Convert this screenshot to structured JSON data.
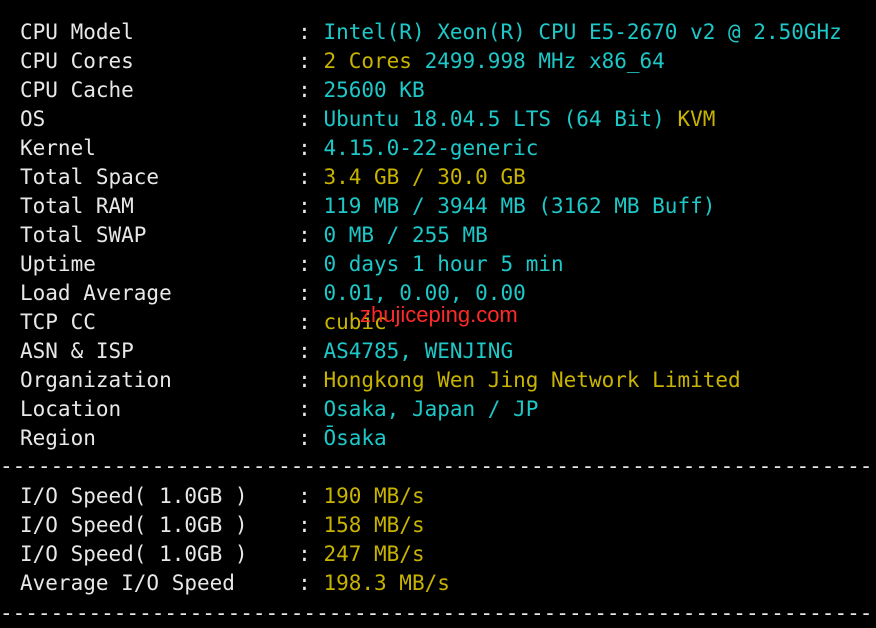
{
  "colors": {
    "cyan": "#1ec8c8",
    "yellow": "#c8b400",
    "text": "#e8e8e8",
    "background": "#000000",
    "watermark": "#ff2a2a"
  },
  "separator": ": ",
  "divider": "------------------------------------------------------------------------",
  "system": [
    {
      "label": "CPU Model",
      "parts": [
        {
          "t": "Intel(R) Xeon(R) CPU E5-2670 v2 @ 2.50GHz",
          "c": "c"
        }
      ]
    },
    {
      "label": "CPU Cores",
      "parts": [
        {
          "t": "2 Cores ",
          "c": "y"
        },
        {
          "t": "2499.998 MHz x86_64",
          "c": "c"
        }
      ]
    },
    {
      "label": "CPU Cache",
      "parts": [
        {
          "t": "25600 KB",
          "c": "c"
        }
      ]
    },
    {
      "label": "OS",
      "parts": [
        {
          "t": "Ubuntu 18.04.5 LTS (64 Bit) ",
          "c": "c"
        },
        {
          "t": "KVM",
          "c": "y"
        }
      ]
    },
    {
      "label": "Kernel",
      "parts": [
        {
          "t": "4.15.0-22-generic",
          "c": "c"
        }
      ]
    },
    {
      "label": "Total Space",
      "parts": [
        {
          "t": "3.4 GB / 30.0 GB",
          "c": "y"
        }
      ]
    },
    {
      "label": "Total RAM",
      "parts": [
        {
          "t": "119 MB / 3944 MB (3162 MB Buff)",
          "c": "c"
        }
      ]
    },
    {
      "label": "Total SWAP",
      "parts": [
        {
          "t": "0 MB / 255 MB",
          "c": "c"
        }
      ]
    },
    {
      "label": "Uptime",
      "parts": [
        {
          "t": "0 days 1 hour 5 min",
          "c": "c"
        }
      ]
    },
    {
      "label": "Load Average",
      "parts": [
        {
          "t": "0.01, 0.00, 0.00",
          "c": "c"
        }
      ]
    },
    {
      "label": "TCP CC",
      "parts": [
        {
          "t": "cubic",
          "c": "y"
        }
      ]
    },
    {
      "label": "ASN & ISP",
      "parts": [
        {
          "t": "AS4785, WENJING",
          "c": "c"
        }
      ]
    },
    {
      "label": "Organization",
      "parts": [
        {
          "t": "Hongkong Wen Jing Network Limited",
          "c": "y"
        }
      ]
    },
    {
      "label": "Location",
      "parts": [
        {
          "t": "Osaka, Japan / JP",
          "c": "c"
        }
      ]
    },
    {
      "label": "Region",
      "parts": [
        {
          "t": "Ōsaka",
          "c": "c"
        }
      ]
    }
  ],
  "io": [
    {
      "label": "I/O Speed( 1.0GB )",
      "parts": [
        {
          "t": "190 MB/s",
          "c": "y"
        }
      ]
    },
    {
      "label": "I/O Speed( 1.0GB )",
      "parts": [
        {
          "t": "158 MB/s",
          "c": "y"
        }
      ]
    },
    {
      "label": "I/O Speed( 1.0GB )",
      "parts": [
        {
          "t": "247 MB/s",
          "c": "y"
        }
      ]
    },
    {
      "label": "Average I/O Speed",
      "parts": [
        {
          "t": "198.3 MB/s",
          "c": "y"
        }
      ]
    }
  ],
  "watermark": "zhujiceping.com"
}
